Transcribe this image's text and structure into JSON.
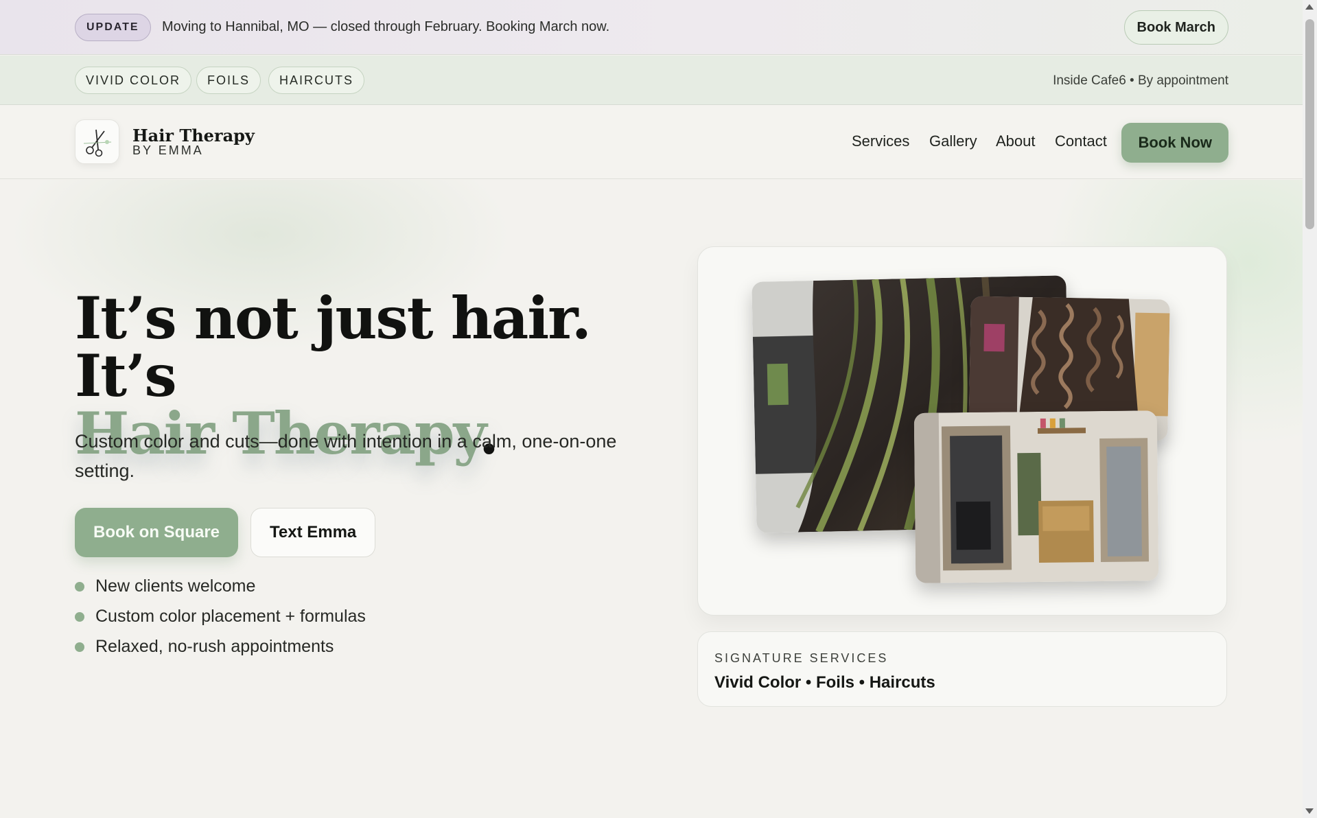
{
  "announcement": {
    "badge": "UPDATE",
    "message": "Moving to Hannibal, MO — closed through February. Booking March now.",
    "cta": "Book March"
  },
  "tags_bar": {
    "tags": [
      "VIVID COLOR",
      "FOILS",
      "HAIRCUTS"
    ],
    "info": "Inside Cafe6 • By appointment"
  },
  "nav": {
    "brand_name": "Hair Therapy",
    "brand_sub": "BY EMMA",
    "links": [
      "Services",
      "Gallery",
      "About",
      "Contact"
    ],
    "cta": "Book Now"
  },
  "hero": {
    "headline_part1": "It’s not just hair. It’s",
    "headline_accent": "Hair Therapy",
    "headline_end": ".",
    "subtext": "Custom color and cuts—done with intention in a calm, one-on-one setting.",
    "primary_cta": "Book on Square",
    "secondary_cta": "Text Emma",
    "bullets": [
      "New clients welcome",
      "Custom color placement + formulas",
      "Relaxed, no-rush appointments"
    ]
  },
  "signature": {
    "label": "SIGNATURE SERVICES",
    "value": "Vivid Color • Foils • Haircuts"
  },
  "colors": {
    "accent_green": "#8fae8e",
    "update_badge": "#ddd5e5",
    "text_dark": "#111210"
  },
  "icons": {
    "logo": "scissors-icon"
  }
}
